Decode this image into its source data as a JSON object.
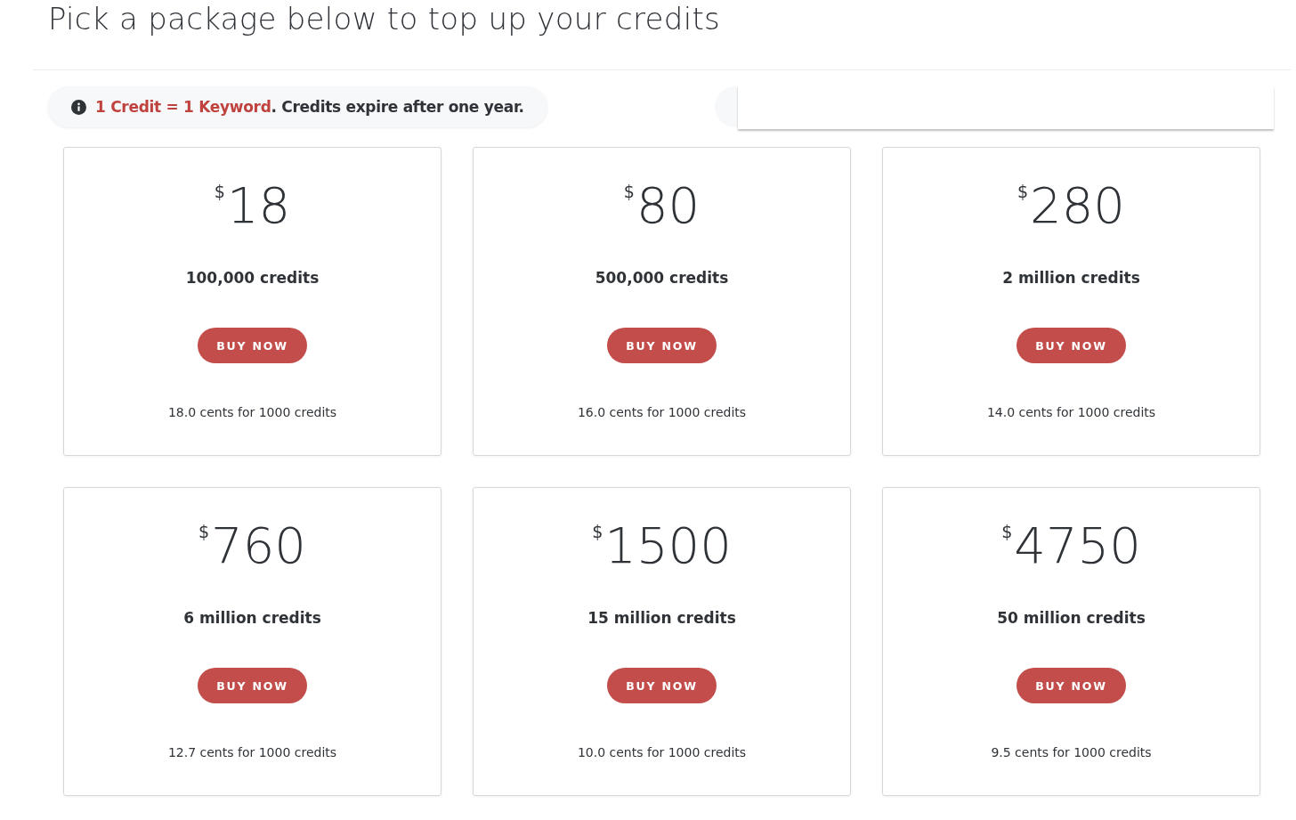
{
  "title": "Pick a package below to top up your credits",
  "info": {
    "highlight": "1 Credit = 1 Keyword",
    "text": ". Credits expire after one year."
  },
  "packages": [
    {
      "currency": "$",
      "price": "18",
      "credits": "100,000 credits",
      "button": "BUY NOW",
      "rate": "18.0 cents for 1000 credits"
    },
    {
      "currency": "$",
      "price": "80",
      "credits": "500,000 credits",
      "button": "BUY NOW",
      "rate": "16.0 cents for 1000 credits"
    },
    {
      "currency": "$",
      "price": "280",
      "credits": "2 million credits",
      "button": "BUY NOW",
      "rate": "14.0 cents for 1000 credits"
    },
    {
      "currency": "$",
      "price": "760",
      "credits": "6 million credits",
      "button": "BUY NOW",
      "rate": "12.7 cents for 1000 credits"
    },
    {
      "currency": "$",
      "price": "1500",
      "credits": "15 million credits",
      "button": "BUY NOW",
      "rate": "10.0 cents for 1000 credits"
    },
    {
      "currency": "$",
      "price": "4750",
      "credits": "50 million credits",
      "button": "BUY NOW",
      "rate": "9.5 cents for 1000 credits"
    }
  ]
}
